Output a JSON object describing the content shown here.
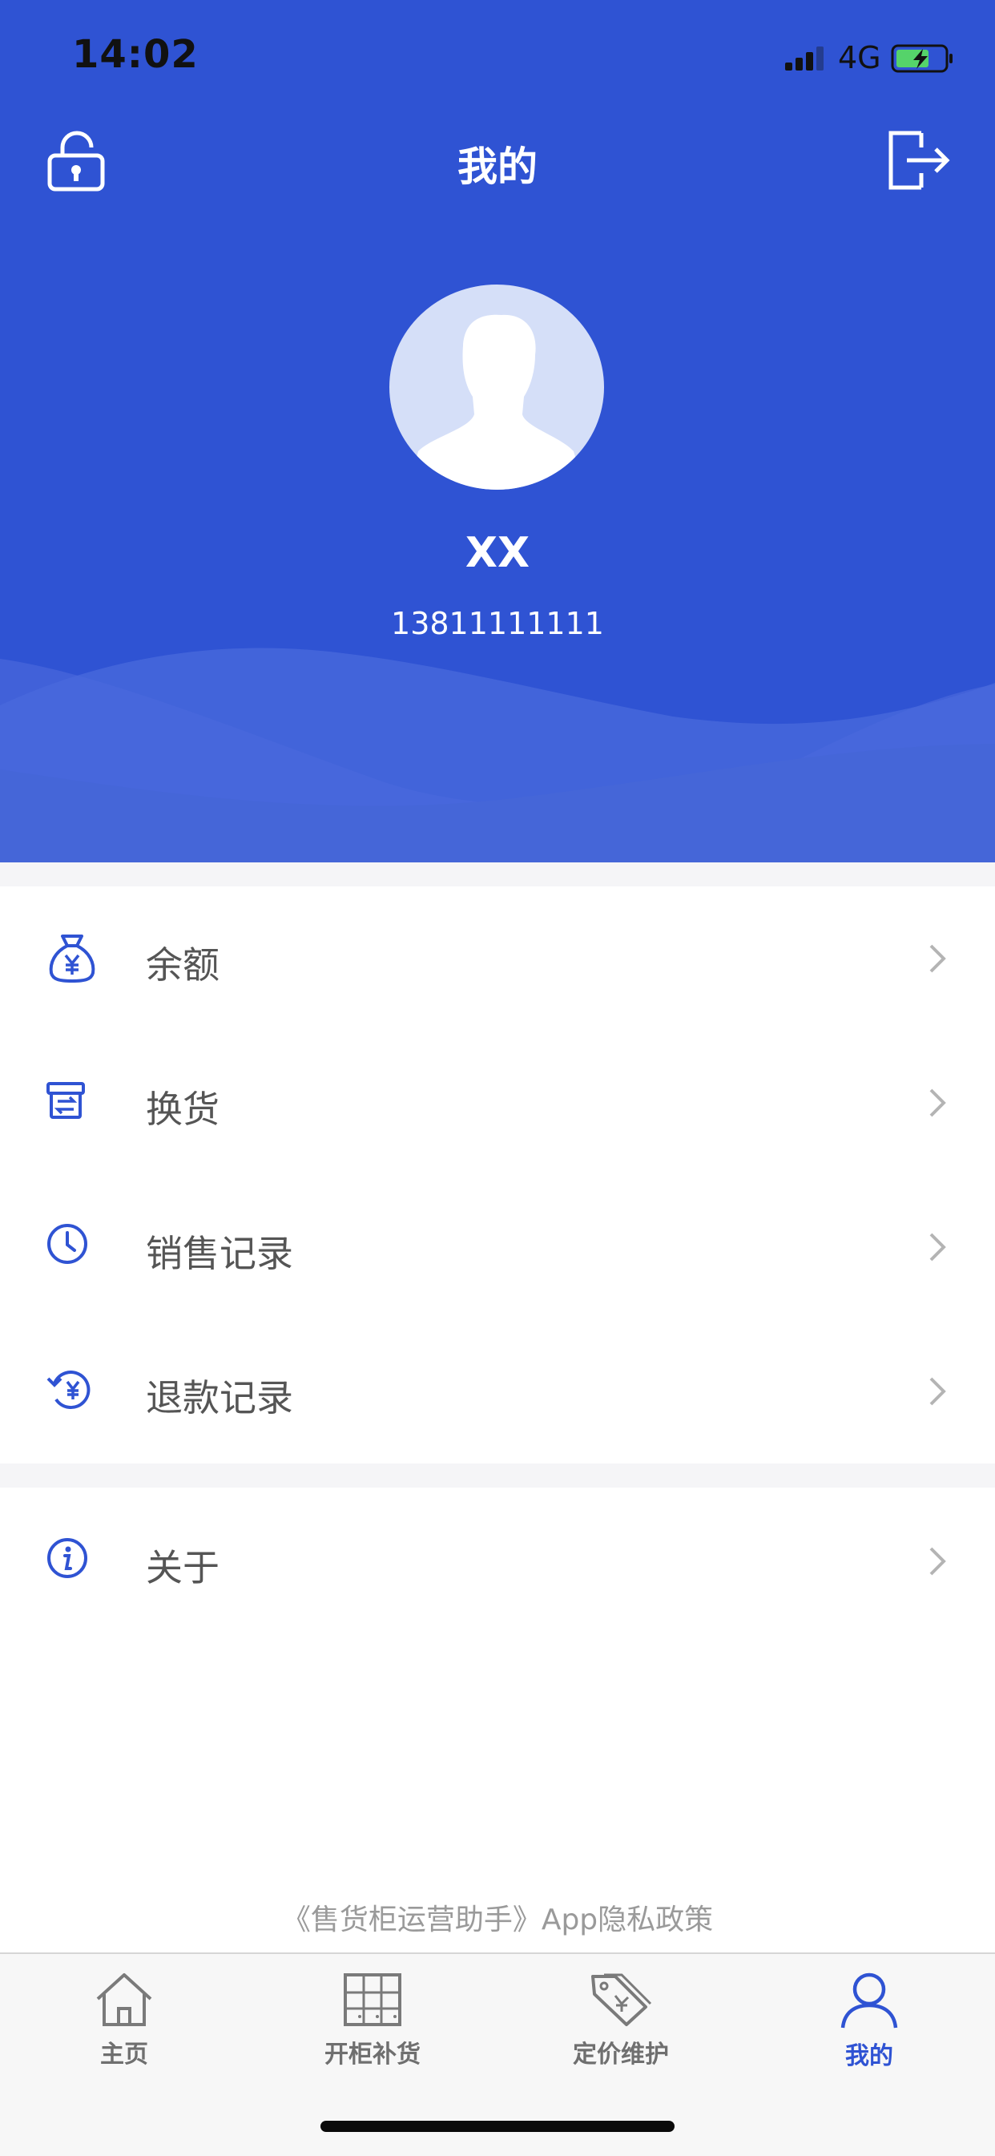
{
  "status_bar": {
    "time": "14:02",
    "network": "4G"
  },
  "header": {
    "title": "我的",
    "lock_icon": "lock-icon",
    "logout_icon": "logout-icon",
    "background": "#2f53d3"
  },
  "profile": {
    "name": "XX",
    "phone": "13811111111"
  },
  "menu": [
    {
      "label": "余额",
      "icon": "money-bag-icon"
    },
    {
      "label": "换货",
      "icon": "exchange-box-icon"
    },
    {
      "label": "销售记录",
      "icon": "clock-icon"
    },
    {
      "label": "退款记录",
      "icon": "refund-icon"
    }
  ],
  "about": {
    "label": "关于",
    "icon": "info-icon"
  },
  "policy": "《售货柜运营助手》App隐私政策",
  "tabs": [
    {
      "label": "主页",
      "icon": "home-icon"
    },
    {
      "label": "开柜补货",
      "icon": "cabinet-icon"
    },
    {
      "label": "定价维护",
      "icon": "price-tag-icon"
    },
    {
      "label": "我的",
      "icon": "user-icon",
      "active": true
    }
  ],
  "colors": {
    "accent": "#2f53d3",
    "text": "#555555",
    "inactive": "#6f6f6f"
  }
}
